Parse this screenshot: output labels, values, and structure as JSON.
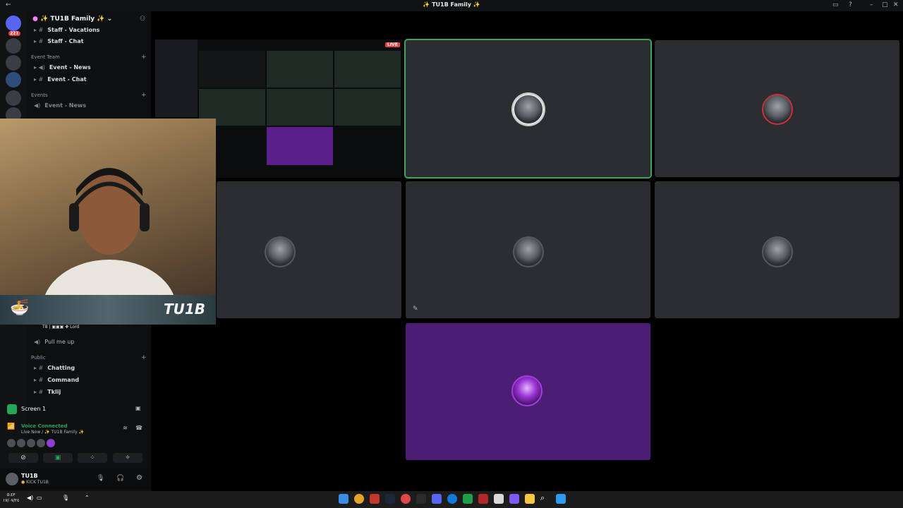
{
  "window": {
    "title": "✨ TU1B Family ✨"
  },
  "rail": {
    "badge_top": "221"
  },
  "sidebar": {
    "server_name": "✨ TU1B Family ✨",
    "channels_top": [
      {
        "name": "Staff - Vacations"
      },
      {
        "name": "Staff - Chat"
      }
    ],
    "category_event_team": "Event Team",
    "event_team_channels": [
      {
        "name": "Event - News"
      },
      {
        "name": "Event - Chat"
      }
    ],
    "category_events": "Events",
    "events_channels": [
      {
        "name": "Event - News"
      }
    ],
    "voice_member": "T8 | ▣▣▣ ✤ Lord",
    "voice_channel": "Pull me up",
    "category_public": "Public",
    "public_channels": [
      {
        "name": "Chatting"
      },
      {
        "name": "Command"
      },
      {
        "name": "Tklij"
      }
    ]
  },
  "screenshare_panel": {
    "label": "Screen 1"
  },
  "voice": {
    "status": "Voice Connected",
    "location": "Live Now / ✨ TU1B Family ✨"
  },
  "user": {
    "name": "TU1B",
    "status": "KICK TU1B"
  },
  "stage": {
    "live_badge": "LIVE"
  },
  "webcam": {
    "banner_text": "TU1B"
  },
  "taskbar": {
    "clock_time": "٥:٤٣",
    "clock_date": "١٧/٠٧/٢٤"
  }
}
